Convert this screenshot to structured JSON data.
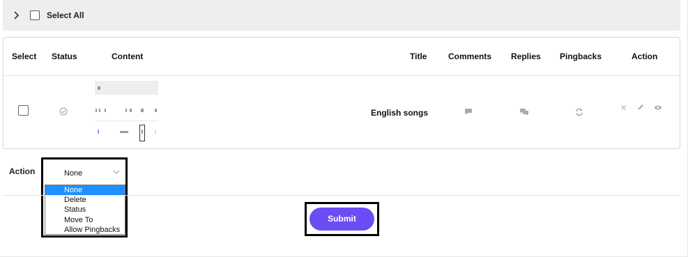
{
  "topbar": {
    "select_all_label": "Select All"
  },
  "table": {
    "headers": {
      "select": "Select",
      "status": "Status",
      "content": "Content",
      "title": "Title",
      "comments": "Comments",
      "replies": "Replies",
      "pingbacks": "Pingbacks",
      "action": "Action"
    },
    "rows": [
      {
        "title": "English songs",
        "status_icon": "check-circle-icon",
        "checked": false
      }
    ]
  },
  "bulk_action": {
    "label": "Action",
    "selected": "None",
    "options": [
      "None",
      "Delete",
      "Status",
      "Move To",
      "Allow Pingbacks"
    ]
  },
  "submit": {
    "label": "Submit"
  },
  "colors": {
    "accent": "#6c4cf5",
    "option_highlight": "#1e90ff",
    "topbar_bg": "#efeeec"
  },
  "icons": [
    "chevron-right-icon",
    "comment-icon",
    "replies-icon",
    "refresh-icon",
    "close-icon",
    "edit-icon",
    "view-icon"
  ]
}
